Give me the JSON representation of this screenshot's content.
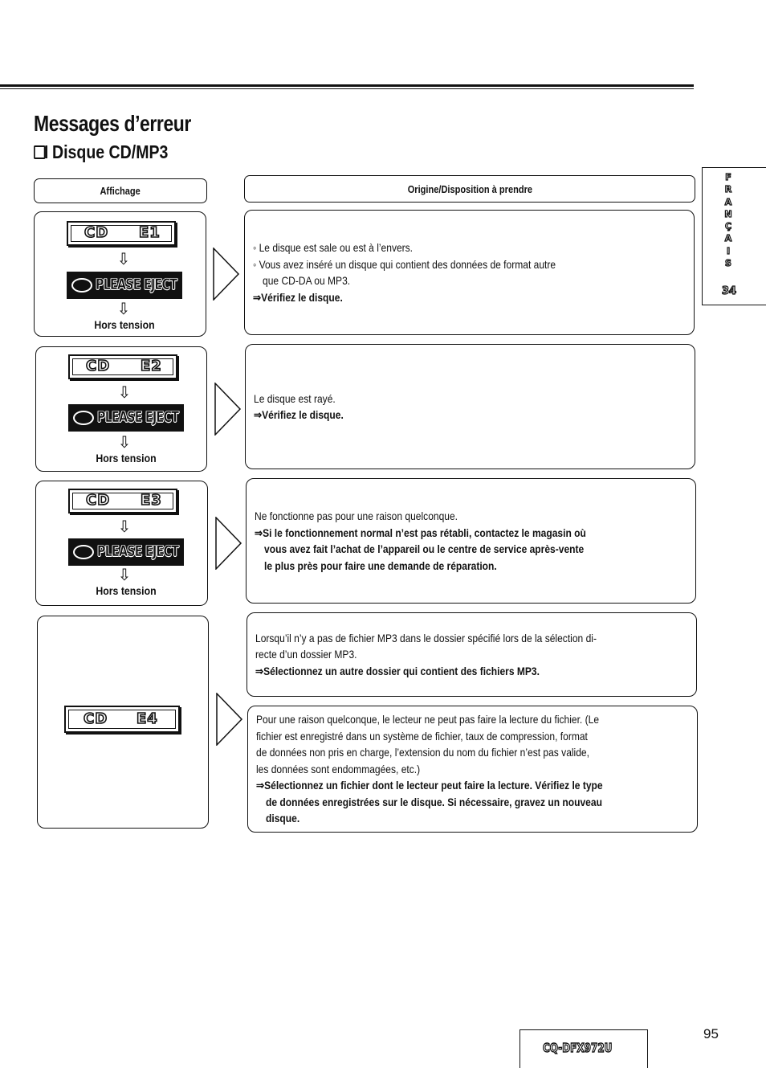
{
  "page": {
    "title": "Messages d’erreur",
    "subtitle": "Disque CD/MP3",
    "language_tab": {
      "letters": [
        "F",
        "R",
        "A",
        "N",
        "Ç",
        "A",
        "I",
        "S"
      ],
      "label": "FRANÇAIS",
      "section_number": "34"
    },
    "model": "CQ-DFX972U",
    "page_number": "95"
  },
  "table": {
    "headers": {
      "display": "Affichage",
      "cause": "Origine/Disposition à prendre"
    },
    "rows": [
      {
        "display": {
          "lcd_left": "CD",
          "lcd_code": "E1",
          "eject_text": "PLEASE EJECT",
          "arrow": "⇩",
          "final": "Hors tension"
        },
        "cause": [
          {
            "style": "bullet",
            "text": "Le disque est sale ou est à l’envers."
          },
          {
            "style": "bullet",
            "text": "Vous avez inséré un disque qui contient des données de format autre"
          },
          {
            "style": "indent",
            "text": "que CD-DA ou MP3."
          },
          {
            "style": "action",
            "text": "⇒Vérifiez le disque."
          }
        ]
      },
      {
        "display": {
          "lcd_left": "CD",
          "lcd_code": "E2",
          "eject_text": "PLEASE EJECT",
          "arrow": "⇩",
          "final": "Hors tension"
        },
        "cause": [
          {
            "style": "plain",
            "text": "Le disque est rayé."
          },
          {
            "style": "action",
            "text": "⇒Vérifiez le disque."
          }
        ]
      },
      {
        "display": {
          "lcd_left": "CD",
          "lcd_code": "E3",
          "eject_text": "PLEASE EJECT",
          "arrow": "⇩",
          "final": "Hors tension"
        },
        "cause": [
          {
            "style": "plain",
            "text": "Ne fonctionne pas pour une raison quelconque."
          },
          {
            "style": "action",
            "text": "⇒Si le fonctionnement normal n’est pas rétabli, contactez le magasin où"
          },
          {
            "style": "action-indent",
            "text": "vous avez fait l’achat de l’appareil ou le centre de service après-vente"
          },
          {
            "style": "action-indent",
            "text": "le plus près pour faire une demande de réparation."
          }
        ]
      },
      {
        "display": {
          "lcd_left": "CD",
          "lcd_code": "E4"
        },
        "causes": [
          [
            {
              "style": "plain",
              "text": "Lorsqu’il n’y a pas de fichier MP3 dans le dossier spécifié lors de la sélection di-"
            },
            {
              "style": "plain",
              "text": "recte d’un dossier MP3."
            },
            {
              "style": "action",
              "text": "⇒Sélectionnez un autre dossier qui contient des fichiers MP3."
            }
          ],
          [
            {
              "style": "plain",
              "text": "Pour une raison quelconque, le lecteur ne peut pas faire la lecture du fichier. (Le"
            },
            {
              "style": "plain",
              "text": "fichier est enregistré dans un système de fichier, taux de compression, format"
            },
            {
              "style": "plain",
              "text": "de données non pris en charge, l’extension du nom du fichier n’est pas valide,"
            },
            {
              "style": "plain",
              "text": "les données sont endommagées, etc.)"
            },
            {
              "style": "action",
              "text": "⇒Sélectionnez un fichier dont le lecteur peut faire la lecture. Vérifiez le type"
            },
            {
              "style": "action-indent",
              "text": "de données enregistrées sur le disque. Si nécessaire, gravez un nouveau"
            },
            {
              "style": "action-indent",
              "text": "disque."
            }
          ]
        ]
      }
    ]
  }
}
